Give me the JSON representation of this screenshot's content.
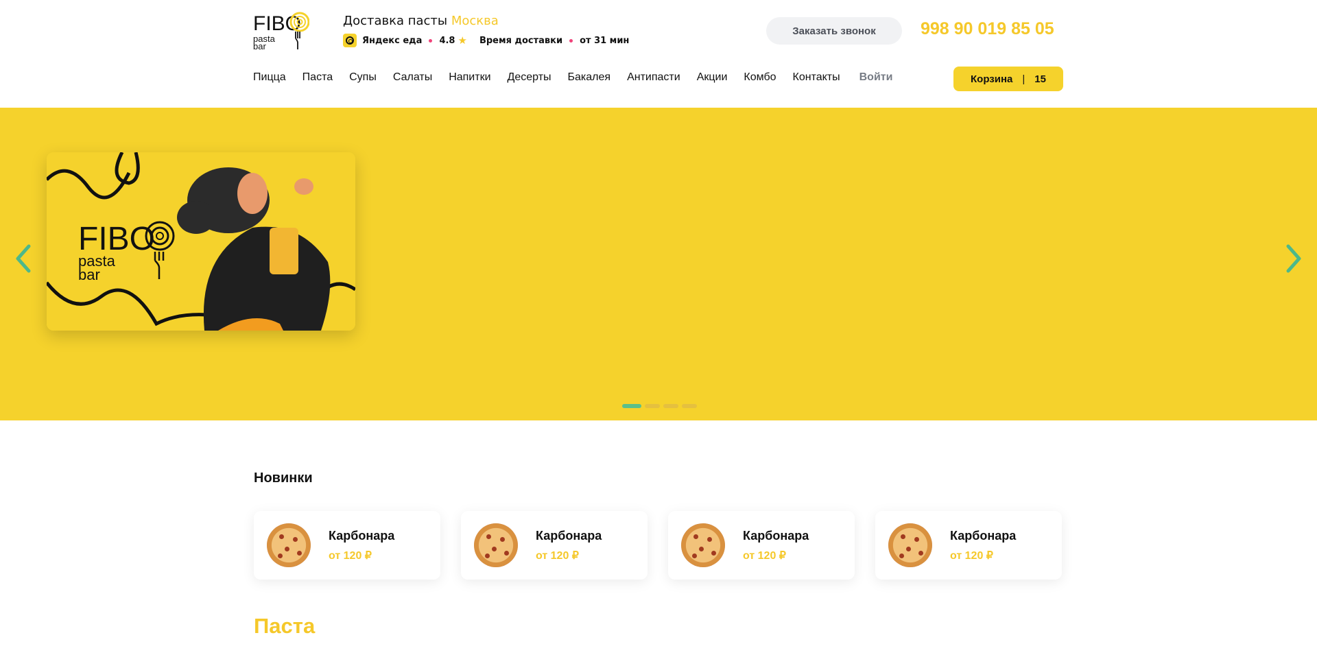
{
  "colors": {
    "accent": "#f5d22c",
    "accent_text": "#f5c82a",
    "slider_active": "#5bbf8a",
    "rating_dot": "#f0437a"
  },
  "logo": {
    "line1": "FIBO",
    "line2": "pasta",
    "line3": "bar"
  },
  "header": {
    "delivery_title": "Доставка пасты",
    "city": "Москва",
    "yandex_label": "Яндекс еда",
    "rating": "4.8",
    "delivery_time_label": "Время доставки",
    "delivery_time_value": "от 31 мин",
    "call_button": "Заказать звонок",
    "phone": "998 90 019 85 05"
  },
  "nav": {
    "items": [
      "Пицца",
      "Паста",
      "Супы",
      "Салаты",
      "Напитки",
      "Десерты",
      "Бакалея",
      "Антипасти",
      "Акции",
      "Комбо",
      "Контакты"
    ],
    "login": "Войти",
    "cart_label": "Корзина",
    "cart_count": "15"
  },
  "hero": {
    "banner_logo": {
      "line1": "FIBO",
      "line2": "pasta",
      "line3": "bar"
    },
    "slides_count": 4,
    "active_slide": 0
  },
  "new_section": {
    "title": "Новинки",
    "items": [
      {
        "name": "Карбонара",
        "price": "от 120 ₽"
      },
      {
        "name": "Карбонара",
        "price": "от 120 ₽"
      },
      {
        "name": "Карбонара",
        "price": "от 120 ₽"
      },
      {
        "name": "Карбонара",
        "price": "от 120 ₽"
      }
    ]
  },
  "pasta_section": {
    "title": "Паста"
  }
}
